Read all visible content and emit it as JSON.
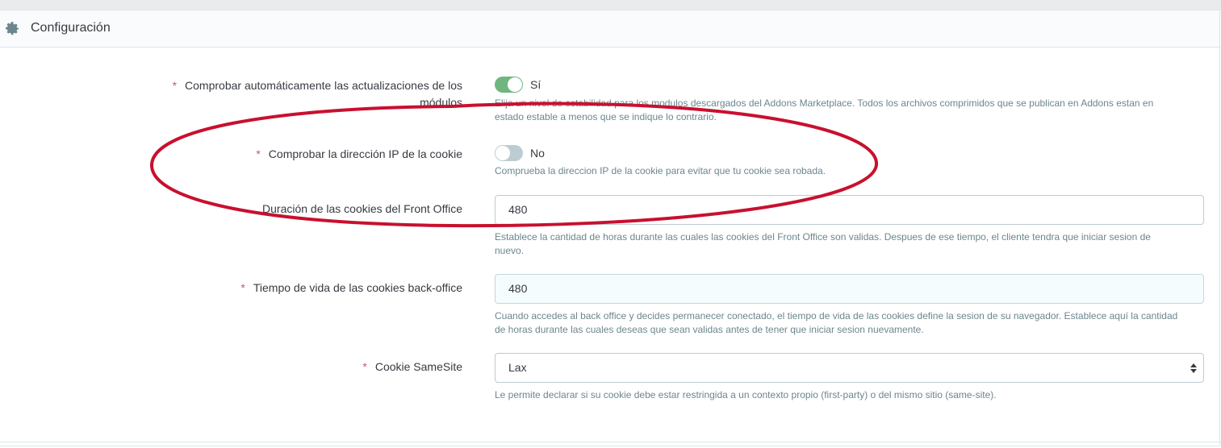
{
  "panel": {
    "title": "Configuración",
    "header_icon": "gear-icon"
  },
  "fields": {
    "check_updates": {
      "label": "Comprobar automáticamente las actualizaciones de los",
      "label_line2": "módulos",
      "required": "*",
      "value": "Sí",
      "state": "on",
      "help_line1": "Elija un nivel de estabilidad para los modulos descargados del Addons Marketplace. Todos los archivos comprimidos que se publican en Addons estan en",
      "help_line2": "estado estable a menos que se indique lo contrario."
    },
    "cookie_ip": {
      "label": "Comprobar la dirección IP de la cookie",
      "required": "*",
      "value": "No",
      "state": "off",
      "help": "Comprueba la direccion IP de la cookie para evitar que tu cookie sea robada."
    },
    "front_office_lifetime": {
      "label": "Duración de las cookies del Front Office",
      "value": "480",
      "help_line1": "Establece la cantidad de horas durante las cuales las cookies del Front Office son validas. Despues de ese tiempo, el cliente tendra que iniciar sesion de",
      "help_line2": "nuevo."
    },
    "back_office_lifetime": {
      "label": "Tiempo de vida de las cookies back-office",
      "required": "*",
      "value": "480",
      "help_line1": "Cuando accedes al back office y decides permanecer conectado, el tiempo de vida de las cookies define la sesion de su navegador. Establece aquí la cantidad",
      "help_line2": "de horas durante las cuales deseas que sean validas antes de tener que iniciar sesion nuevamente."
    },
    "samesite": {
      "label": "Cookie SameSite",
      "required": "*",
      "selected": "Lax",
      "help": "Le permite declarar si su cookie debe estar restringida a un contexto propio (first-party) o del mismo sitio (same-site)."
    }
  },
  "colors": {
    "toggle_on": "#70b580",
    "toggle_off": "#bbcdd2",
    "required_star": "#c05c67",
    "annotation_ellipse": "#c8102e"
  }
}
